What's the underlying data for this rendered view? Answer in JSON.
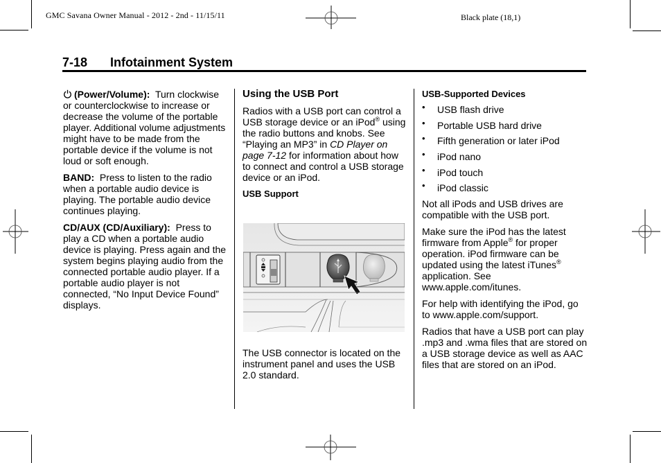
{
  "print_marks": {
    "left_slug": "GMC Savana Owner Manual - 2012 - 2nd - 11/15/11",
    "right_slug": "Black plate (18,1)"
  },
  "header": {
    "page_number": "7-18",
    "section_title": "Infotainment System"
  },
  "column1": {
    "power": {
      "icon": "power-icon",
      "label": "(Power/Volume):",
      "text": "Turn clockwise or counterclockwise to increase or decrease the volume of the portable player. Additional volume adjustments might have to be made from the portable device if the volume is not loud or soft enough."
    },
    "band": {
      "label": "BAND:",
      "text": "Press to listen to the radio when a portable audio device is playing. The portable audio device continues playing."
    },
    "cdaux": {
      "label": "CD/AUX (CD/Auxiliary):",
      "text": "Press to play a CD when a portable audio device is playing. Press again and the system begins playing audio from the connected portable audio player. If a portable audio player is not connected, “No Input Device Found” displays."
    }
  },
  "column2": {
    "heading": "Using the USB Port",
    "intro": {
      "part1": "Radios with a USB port can control a USB storage device or an iPod",
      "reg": "®",
      "part2": " using the radio buttons and knobs. See “Playing an MP3” in ",
      "link": "CD Player on page 7-12",
      "part3": " for information about how to connect and control a USB storage device or an iPod."
    },
    "subheading": "USB Support",
    "figure_alt": "USB port location on instrument panel with arrow pointing to USB connector",
    "caption": "The USB connector is located on the instrument panel and uses the USB 2.0 standard."
  },
  "column3": {
    "subheading": "USB-Supported Devices",
    "bullet": "•",
    "devices": [
      "USB flash drive",
      "Portable USB hard drive",
      "Fifth generation or later iPod",
      "iPod nano",
      "iPod touch",
      "iPod classic"
    ],
    "compat": "Not all iPods and USB drives are compatible with the USB port.",
    "firmware": {
      "part1": "Make sure the iPod has the latest firmware from Apple",
      "reg1": "®",
      "part2": " for proper operation. iPod firmware can be updated using the latest iTunes",
      "reg2": "®",
      "part3": " application. See www.apple.com/itunes."
    },
    "help": "For help with identifying the iPod, go to www.apple.com/support.",
    "formats": "Radios that have a USB port can play .mp3 and .wma files that are stored on a USB storage device as well as AAC files that are stored on an iPod."
  }
}
